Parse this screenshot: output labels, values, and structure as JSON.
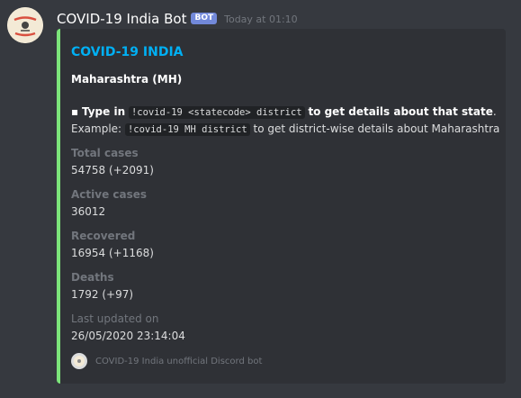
{
  "message": {
    "username": "COVID-19 India Bot",
    "bot_tag": "BOT",
    "timestamp": "Today at 01:10"
  },
  "embed": {
    "accent_color": "#7ce47a",
    "title": "COVID-19 INDIA",
    "state_heading": "Maharashtra (MH)",
    "description": {
      "bullet": "▪",
      "instruction_prefix": "Type in",
      "instruction_code": "!covid-19 <statecode> district",
      "instruction_suffix": "to get details about that state",
      "instruction_end": ".",
      "example_prefix": "Example:",
      "example_code": "!covid-19 MH district",
      "example_suffix": "to get district-wise details about Maharashtra"
    },
    "fields": [
      {
        "name": "Total cases",
        "value": "54758 (+2091)"
      },
      {
        "name": "Active cases",
        "value": "36012"
      },
      {
        "name": "Recovered",
        "value": "16954 (+1168)"
      },
      {
        "name": "Deaths",
        "value": "1792 (+97)"
      },
      {
        "name": "Last updated on",
        "value": "26/05/2020 23:14:04"
      }
    ],
    "footer_text": "COVID-19 India unofficial Discord bot"
  },
  "avatar": {
    "badge_line1": "STAY HOME",
    "badge_line2": "STAY SAFE"
  }
}
